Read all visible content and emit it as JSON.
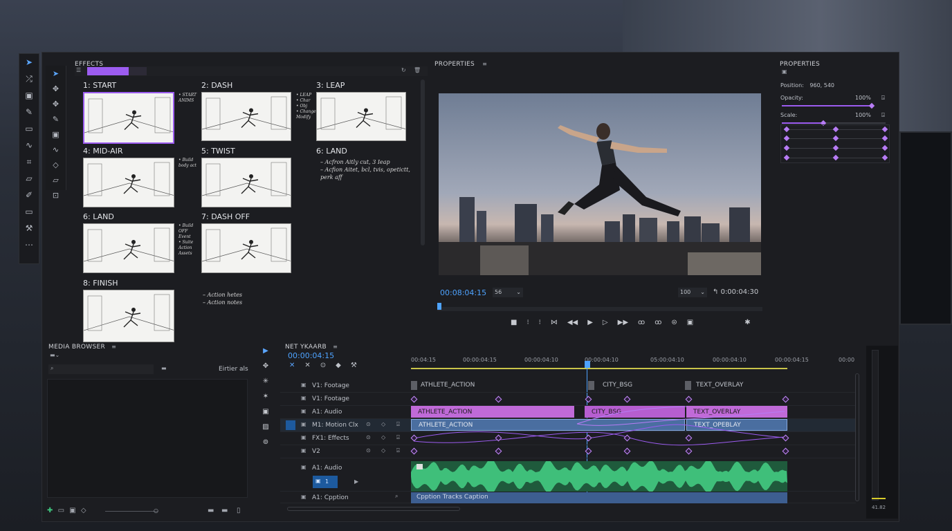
{
  "effects_panel": {
    "title": "EFFECTS"
  },
  "storyboard": [
    {
      "label": "1: START",
      "notes": [
        "• START",
        "ANIMS"
      ]
    },
    {
      "label": "2: DASH",
      "notes": [
        "• LEAP",
        "• Char",
        "• Obj",
        "• Change",
        "Modify"
      ]
    },
    {
      "label": "3: LEAP",
      "notes": []
    },
    {
      "label": "4: MID-AIR",
      "notes": [
        "• Build",
        "body act"
      ]
    },
    {
      "label": "5: TWIST",
      "notes": []
    },
    {
      "label": "6: LAND",
      "notes": [
        "– Acfron Aitly cut, 3 Ieap",
        "– Acfion Aitet, bcl, tvis, opetictt,",
        "perk aff"
      ]
    },
    {
      "label": "6: LAND",
      "notes": [
        "• Build",
        "OFF",
        "Event",
        "• Suite",
        "Action",
        "Assets"
      ]
    },
    {
      "label": "7: DASH OFF",
      "notes": []
    },
    {
      "label": "8: FINISH",
      "notes": [
        "– Action hetes",
        "– Action notes"
      ]
    }
  ],
  "viewer": {
    "title": "PROPERTIES",
    "timecode": "00:08:04:15",
    "fit": "56",
    "zoom": "100",
    "duration": "0:00:04:30"
  },
  "properties": {
    "title": "PROPERTIES",
    "position_label": "Position:",
    "position_value": "960, 540",
    "opacity_label": "Opacity:",
    "opacity_value": "100%",
    "opacity_level": 1.0,
    "scale_label": "Scale:",
    "scale_value": "100%",
    "scale_level": 0.4
  },
  "media_browser": {
    "title": "MEDIA BROWSER",
    "search_placeholder": "",
    "folder_label": "Eirtier als"
  },
  "timeline": {
    "title": "NET YKAARB",
    "timecode": "00:00:04:15",
    "ruler": [
      "00:04:15",
      "00:00:04:15",
      "00:00:04:10",
      "00:00:04:10",
      "05:00:04:10",
      "00:00:04:10",
      "00:00:04:15",
      "00:00"
    ],
    "tracks": [
      {
        "name": "V1: Footage"
      },
      {
        "name": "V1: Footage"
      },
      {
        "name": "A1: Audio"
      },
      {
        "name": "M1: Motion Clx"
      },
      {
        "name": "FX1: Effects"
      },
      {
        "name": "V2"
      },
      {
        "name": "A1: Audio"
      },
      {
        "name": "A1: Cpption"
      }
    ],
    "clips_top": [
      "ATHLETE_ACTION",
      "CITY_BSG",
      "TEXT_OVERLAY"
    ],
    "clips_pink": [
      "ATHLETE_ACTION",
      "CITY_BSG",
      "TEXT_OVERLAY"
    ],
    "clips_blue": [
      "ATHLETE_ACTION",
      "TEXT_OPEBLAY"
    ],
    "caption_clip": "Cpption Tracks Caption",
    "a1_badge": "1"
  },
  "meter": {
    "value": "41.82"
  },
  "colors": {
    "accent": "#9c5cf0",
    "timecode": "#4ea3ff",
    "pink_clip": "#c06ad8",
    "blue_clip": "#4a6ea0",
    "audio": "#37a66a"
  }
}
